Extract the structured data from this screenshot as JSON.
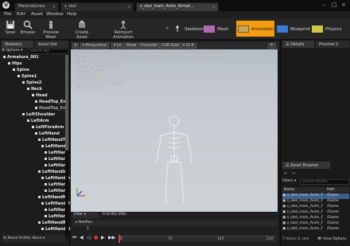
{
  "tabs": [
    {
      "label": "MaterialLines"
    },
    {
      "label": "z_skel"
    },
    {
      "label": "z_skel_main_Anim_Armat..."
    }
  ],
  "menu": [
    "File",
    "Edit",
    "Asset",
    "Window",
    "Help"
  ],
  "toolbar": {
    "buttons": [
      "Save",
      "Browse",
      "Preview Mesh",
      "Create Asset",
      "Reimport Animation"
    ],
    "modes": [
      "Skeleton",
      "Mesh",
      "Animation",
      "Blueprint",
      "Physics"
    ]
  },
  "left_panel": {
    "tabs": [
      "Skeleton",
      "Asset Det"
    ],
    "options_label": "Options",
    "search_placeholder": "Search Ske",
    "footer": "Blend Profile: None",
    "bones": [
      "Armature_001",
      "Hips",
      "Spine",
      "Spine1",
      "Spine2",
      "Neck",
      "Head",
      "HeadTop_End",
      "HeadTop_End",
      "LeftShoulder",
      "LeftArm",
      "LeftForeArm",
      "LeftHand",
      "LeftHandT",
      "LeftHand",
      "LeftHan",
      "LeftHan",
      "LeftHan",
      "LeftHandIn",
      "LeftHandIn",
      "LeftHan",
      "LeftHan",
      "LeftHandM",
      "LeftHandM",
      "LeftHan",
      "LeftHan",
      "LeftHandR",
      "LeftHandRi"
    ]
  },
  "viewport": {
    "buttons": [
      "Perspective",
      "Lit",
      "Show",
      "Character",
      "LOD Auto",
      "x1.0"
    ],
    "info": [
      "Previewing Animation: z_skel_main_Anim_Armature_mixamo_com_Layer0",
      "LOD: 0",
      "Current Screen Size: ...",
      "Triangles: 5,252",
      "Vertices: 4,461",
      "UV Channels: 1",
      "Approx Size: 73x64x238",
      "Frame: 0 / 210"
    ],
    "filter_label": "Filter",
    "time_display": "0 (0.00) (0%)",
    "notifies_label": "Notifies",
    "curve_label": "1",
    "timeline_ticks": [
      "0",
      "70",
      "140",
      "210"
    ]
  },
  "right_panel": {
    "tabs": [
      "Details",
      "Preview S"
    ],
    "asset_browser_tab": "Asset Browser",
    "filters_label": "Filters",
    "search_placeholder": "Search Assets",
    "columns": [
      "Name",
      "Path"
    ],
    "assets": [
      {
        "name": "z_skel_main_Anim_F",
        "path": "/Game"
      },
      {
        "name": "z_skel_main_Anim_F",
        "path": "/Game"
      },
      {
        "name": "z_skel_main_Anim_F",
        "path": "/Game"
      },
      {
        "name": "z_skel_main_Anim_F",
        "path": "/Game"
      },
      {
        "name": "z_skel_main_Anim_F",
        "path": "/Game"
      },
      {
        "name": "z_skel_main_Anim_F",
        "path": "/Game"
      },
      {
        "name": "z_skel_main_Anim_F",
        "path": "/Game"
      }
    ],
    "status": "7 items (1 sele",
    "view_options": "View Options"
  },
  "colors": {
    "accent": "#f39c12",
    "selection": "#3b5e8b",
    "mesh_mode": "#b06bb0",
    "blueprint_mode": "#3a7bd5",
    "physics_mode": "#d0c64a",
    "skeleton_mode": "#d0d0d0"
  }
}
